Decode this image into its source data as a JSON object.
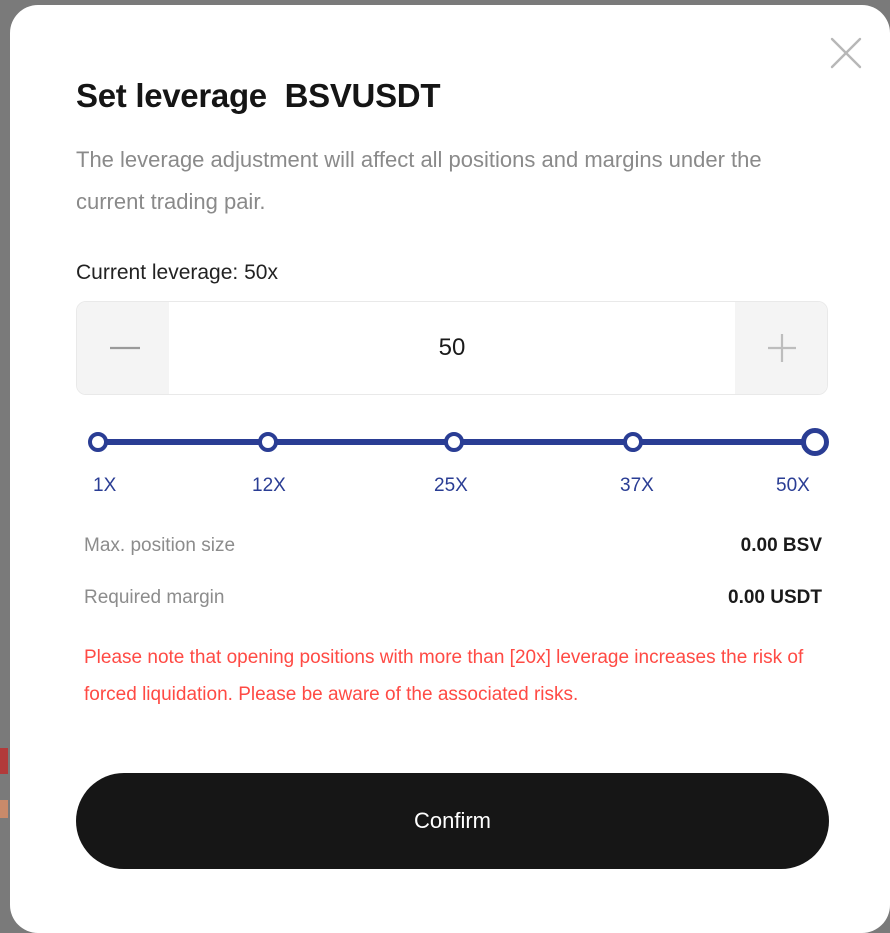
{
  "colors": {
    "accent": "#2a3d94",
    "warning": "#ff4a44",
    "confirm_bg": "#161616",
    "muted_text": "#8a8a8a"
  },
  "dialog": {
    "title": "Set leverage  BSVUSDT",
    "description": "The leverage adjustment will affect all positions and margins under the current trading pair.",
    "current_leverage_label": "Current leverage: 50x",
    "close_icon": "close-icon"
  },
  "stepper": {
    "value": "50",
    "minus_icon": "minus-icon",
    "plus_icon": "plus-icon"
  },
  "slider": {
    "selected": "50X",
    "level": 1.0,
    "ticks": [
      "1X",
      "12X",
      "25X",
      "37X",
      "50X"
    ]
  },
  "info": {
    "max_position_label": "Max. position size",
    "max_position_value": "0.00 BSV",
    "required_margin_label": "Required margin",
    "required_margin_value": "0.00 USDT"
  },
  "warning": {
    "text": "Please note that opening positions with more than [20x] leverage increases the risk of forced liquidation. Please be aware of the associated risks."
  },
  "actions": {
    "confirm_label": "Confirm"
  }
}
